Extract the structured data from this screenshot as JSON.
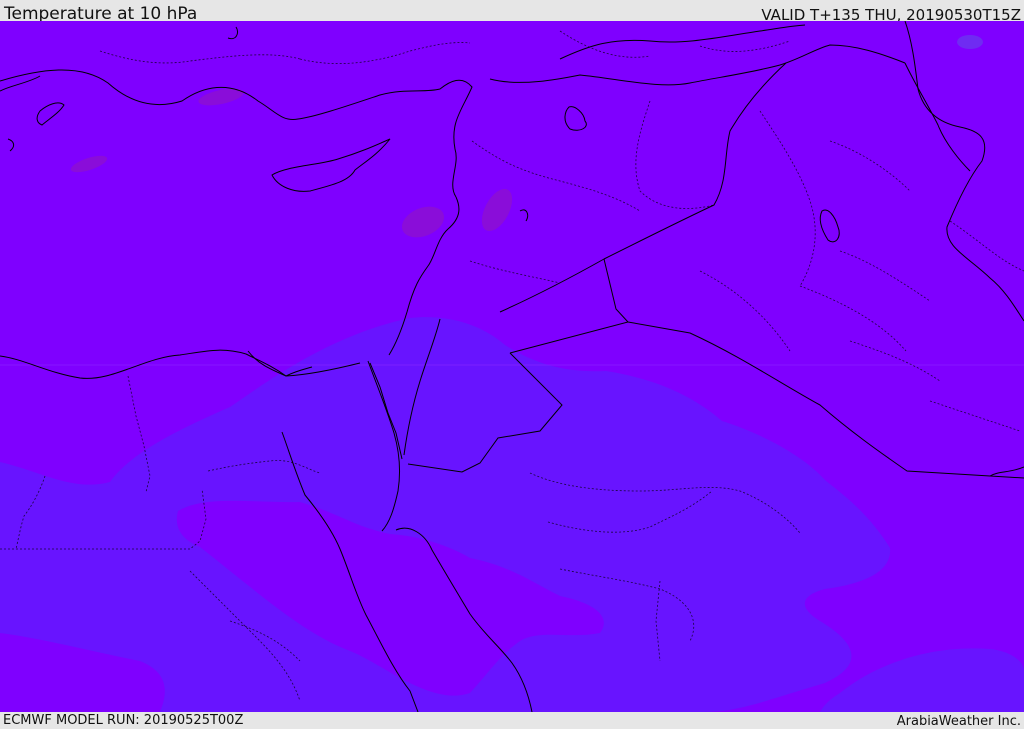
{
  "header": {
    "title": "Temperature at 10 hPa",
    "valid_time": "VALID T+135 THU, 20190530T15Z"
  },
  "footer": {
    "model_run": "ECMWF MODEL RUN: 20190525T00Z",
    "credit": "ArabiaWeather Inc."
  },
  "map": {
    "colors": {
      "background_band": "#7f00ff",
      "cooler_band": "#6814ff",
      "warm_patch": "#8a0dd9",
      "coastline": "#000000",
      "border": "#000000"
    }
  }
}
